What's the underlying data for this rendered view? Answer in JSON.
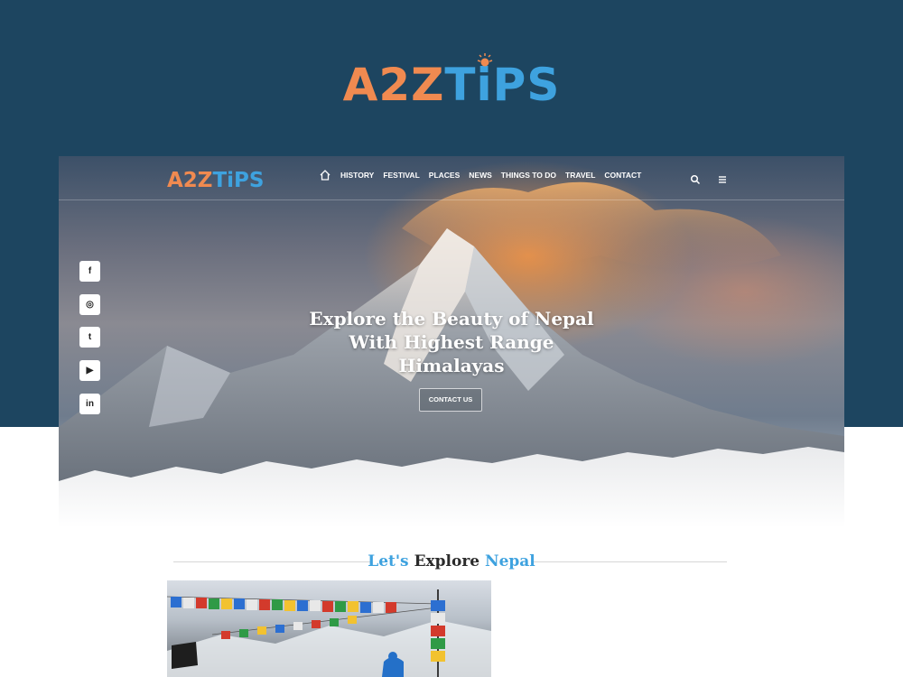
{
  "brand": {
    "logo_part1": "A2Z",
    "logo_part2": "TiPS",
    "color_orange": "#f08a50",
    "color_blue": "#3ea2df",
    "background": "#1d4560"
  },
  "nav": {
    "home_icon": "home-icon",
    "items": [
      "HISTORY",
      "FESTIVAL",
      "PLACES",
      "NEWS",
      "THINGS TO DO",
      "TRAVEL",
      "CONTACT"
    ],
    "search_icon": "search-icon",
    "menu_icon": "hamburger-menu-icon"
  },
  "social": [
    {
      "icon": "facebook-icon",
      "glyph": "f"
    },
    {
      "icon": "instagram-icon",
      "glyph": "◎"
    },
    {
      "icon": "twitter-icon",
      "glyph": "t"
    },
    {
      "icon": "youtube-icon",
      "glyph": "▶"
    },
    {
      "icon": "linkedin-icon",
      "glyph": "in"
    }
  ],
  "hero": {
    "title_line1": "Explore the Beauty of Nepal",
    "title_line2": "With Highest Range",
    "title_line3": "Himalayas",
    "button": "CONTACT US"
  },
  "explore": {
    "word1": "Let's",
    "word2": "Explore",
    "word3": "Nepal"
  }
}
